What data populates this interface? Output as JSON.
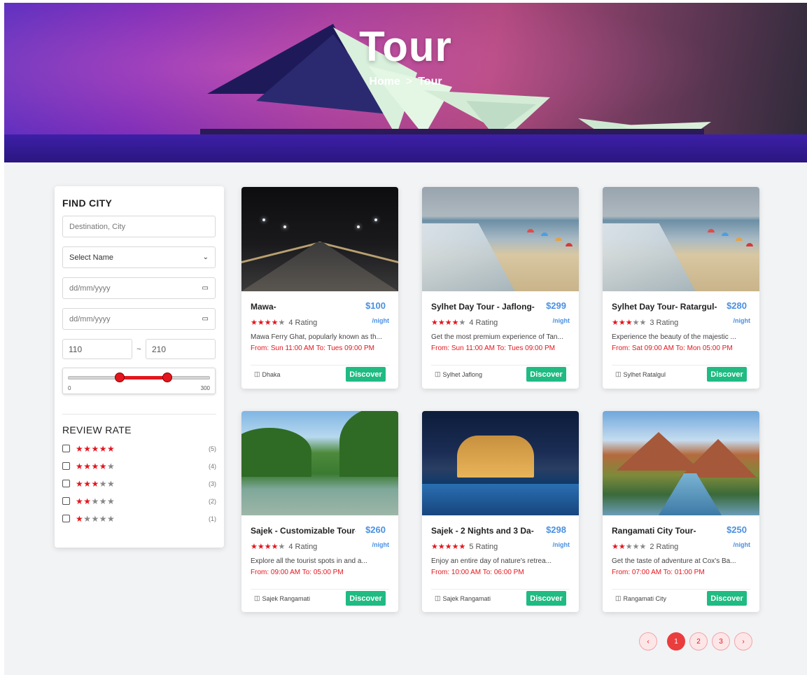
{
  "hero": {
    "title": "Tour",
    "breadcrumb": {
      "home": "Home",
      "separator": ">",
      "current": "Tour"
    }
  },
  "sidebar": {
    "find_city": {
      "heading": "FIND CITY",
      "destination_placeholder": "Destination, City",
      "select_name": "Select Name",
      "date_from": "dd/mm/yyyy",
      "date_to": "dd/mm/yyyy"
    },
    "price": {
      "min": "110",
      "tilde": "~",
      "max": "210",
      "slider_min_label": "0",
      "slider_max_label": "300",
      "range_start": 110,
      "range_end": 210,
      "range_total": 300
    },
    "review": {
      "heading": "REVIEW RATE",
      "rows": [
        {
          "stars_filled": "★★★★★",
          "stars_empty": "",
          "count": "(5)"
        },
        {
          "stars_filled": "★★★★",
          "stars_empty": "★",
          "count": "(4)"
        },
        {
          "stars_filled": "★★★",
          "stars_empty": "★★",
          "count": "(3)"
        },
        {
          "stars_filled": "★★",
          "stars_empty": "★★★",
          "count": "(2)"
        },
        {
          "stars_filled": "★",
          "stars_empty": "★★★★",
          "count": "(1)"
        }
      ]
    }
  },
  "cards": [
    {
      "title": "Mawa-",
      "price": "$100",
      "per": "/night",
      "stars_filled": "★★★★",
      "stars_empty": "★",
      "rating": "4 Rating",
      "desc": "Mawa Ferry Ghat, popularly known as th...",
      "time": "From: Sun 11:00 AM To: Tues 09:00 PM",
      "location": "Dhaka",
      "button": "Discover"
    },
    {
      "title": "Sylhet Day Tour - Jaflong-",
      "price": "$299",
      "per": "/night",
      "stars_filled": "★★★★",
      "stars_empty": "★",
      "rating": "4 Rating",
      "desc": "Get the most premium experience of Tan...",
      "time": "From: Sun 11:00 AM To: Tues 09:00 PM",
      "location": "Sylhet Jaflong",
      "button": "Discover"
    },
    {
      "title": "Sylhet Day Tour- Ratargul-",
      "price": "$280",
      "per": "/night",
      "stars_filled": "★★★",
      "stars_empty": "★★",
      "rating": "3 Rating",
      "desc": "Experience the beauty of the majestic ...",
      "time": "From: Sat 09:00 AM To: Mon 05:00 PM",
      "location": "Sylhet Ratalgul",
      "button": "Discover"
    },
    {
      "title": "Sajek - Customizable Tour-",
      "price": "$260",
      "per": "/night",
      "stars_filled": "★★★★",
      "stars_empty": "★",
      "rating": "4 Rating",
      "desc": "Explore all the tourist spots in and a...",
      "time": "From: 09:00 AM To: 05:00 PM",
      "location": "Sajek Rangamati",
      "button": "Discover"
    },
    {
      "title": "Sajek - 2 Nights and 3 Da-",
      "price": "$298",
      "per": "/night",
      "stars_filled": "★★★★★",
      "stars_empty": "",
      "rating": "5 Rating",
      "desc": "Enjoy an entire day of nature's retrea...",
      "time": "From: 10:00 AM To: 06:00 PM",
      "location": "Sajek Rangamati",
      "button": "Discover"
    },
    {
      "title": "Rangamati City Tour-",
      "price": "$250",
      "per": "/night",
      "stars_filled": "★★",
      "stars_empty": "★★★",
      "rating": "2 Rating",
      "desc": "Get the taste of adventure at Cox's Ba...",
      "time": "From: 07:00 AM To: 01:00 PM",
      "location": "Rangamati City",
      "button": "Discover"
    }
  ],
  "pagination": {
    "prev": "‹",
    "pages": [
      "1",
      "2",
      "3"
    ],
    "next": "›",
    "active": "1"
  },
  "icons": {
    "map": "map-icon",
    "calendar": "calendar-icon",
    "chevron": "chevron-down-icon"
  }
}
